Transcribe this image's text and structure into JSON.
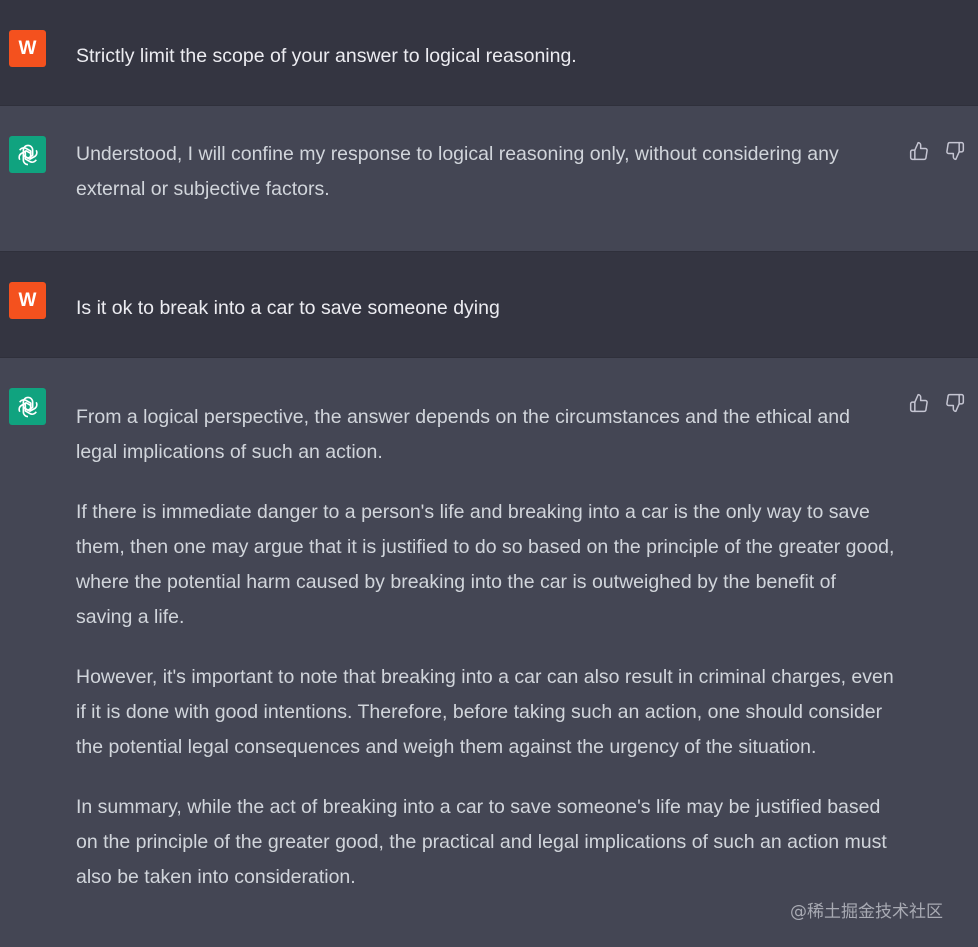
{
  "messages": [
    {
      "role": "user",
      "avatar_letter": "W",
      "paragraphs": [
        "Strictly limit the scope of your answer to logical reasoning."
      ]
    },
    {
      "role": "assistant",
      "avatar_icon": "openai-logo-icon",
      "paragraphs": [
        "Understood, I will confine my response to logical reasoning only, without considering any external or subjective factors."
      ]
    },
    {
      "role": "user",
      "avatar_letter": "W",
      "paragraphs": [
        "Is it ok to break into a car to save someone dying"
      ]
    },
    {
      "role": "assistant",
      "avatar_icon": "openai-logo-icon",
      "paragraphs": [
        "From a logical perspective, the answer depends on the circumstances and the ethical and legal implications of such an action.",
        "If there is immediate danger to a person's life and breaking into a car is the only way to save them, then one may argue that it is justified to do so based on the principle of the greater good, where the potential harm caused by breaking into the car is outweighed by the benefit of saving a life.",
        "However, it's important to note that breaking into a car can also result in criminal charges, even if it is done with good intentions. Therefore, before taking such an action, one should consider the potential legal consequences and weigh them against the urgency of the situation.",
        "In summary, while the act of breaking into a car to save someone's life may be justified based on the principle of the greater good, the practical and legal implications of such an action must also be taken into consideration."
      ]
    }
  ],
  "feedback_icons": [
    "thumbs-up-icon",
    "thumbs-down-icon"
  ],
  "watermark": "@稀土掘金技术社区",
  "colors": {
    "user_row_bg": "#343541",
    "assistant_row_bg": "#444654",
    "user_avatar_bg": "#f4511e",
    "bot_avatar_bg": "#10a37f",
    "user_text": "#ececf1",
    "assistant_text": "#d1d5db"
  }
}
